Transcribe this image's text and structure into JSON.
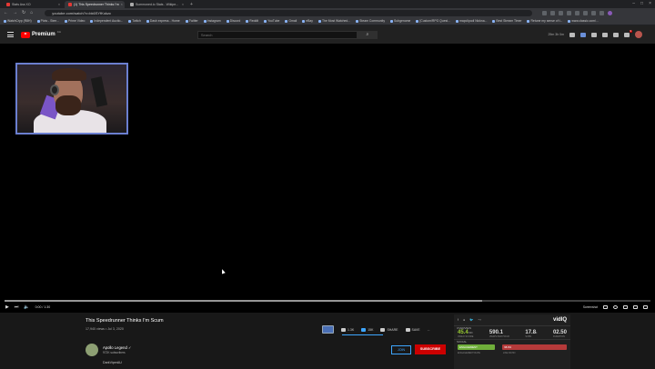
{
  "browser": {
    "tabs": [
      {
        "label": "Stats Ass XO",
        "active": false
      },
      {
        "label": "(1) This Speedrunner Thinks I'm",
        "active": true
      },
      {
        "label": "Summoned.io Stats - Wikipe...",
        "active": false
      }
    ],
    "new_tab": "+",
    "url": "youtube.com/watch?v=bk6SYfKokzc",
    "bookmarks": [
      "WatchCryp (R8H)",
      "Plots - Stee...",
      "Prime Video",
      "Independent Auctio...",
      "Twitch",
      "Dash express - Home",
      "Twitter",
      "Instagram",
      "Discord",
      "Reddit",
      "YouTube",
      "Gmail",
      "eBay",
      "The Most Watched...",
      "Steam Community",
      "Subgenome",
      "[Custom/RPG Quest...",
      "mapclipodi Nickna...",
      "Best Stream Timer",
      "Retune my sense of t...",
      "www.classic.com/..."
    ]
  },
  "youtube": {
    "logo_text": "Premium",
    "country_code": "CA",
    "search_placeholder": "Search",
    "search_button": "⌕",
    "header_counter": "29m 3h 0m",
    "notifications_badge": "9"
  },
  "player": {
    "time": "0:00 / 1:30",
    "chapter_label": "Screenshot",
    "progress_loaded": 0.74
  },
  "video": {
    "title": "This Speedrunner Thinks I'm Scum",
    "meta": "17,940 views • Jul 3, 2020",
    "like_count": "1.3K",
    "dislike_count": "15K",
    "share_label": "SHARE",
    "save_label": "SAVE",
    "more_label": "...",
    "channel_name": "Apollo Legend ✓",
    "subscribers": "972K subscribers",
    "description": "DarkViperAU",
    "join_label": "JOIN",
    "subscribe_label": "SUBSCRIBE"
  },
  "vidiq": {
    "logo": "vidIQ",
    "overview_label": "OVERVIEW",
    "stats": [
      {
        "value": "45.4",
        "unit": "/100",
        "label": "VIDEO SCORE",
        "highlight": true
      },
      {
        "value": "590.1",
        "unit": "",
        "label": "VIEWS PER HOUR",
        "highlight": false
      },
      {
        "value": "17.8",
        "unit": "k",
        "label": "SUBS",
        "highlight": false
      },
      {
        "value": "02.50",
        "unit": "",
        "label": "DURATION",
        "highlight": false
      }
    ],
    "social_label": "SOCIAL",
    "engagement_bar": "ENGAGEMENT",
    "engagement_label": "ENGAGEMENT RATE",
    "likes_bar": "98.9%",
    "likes_label": "LIKE RATIO"
  }
}
